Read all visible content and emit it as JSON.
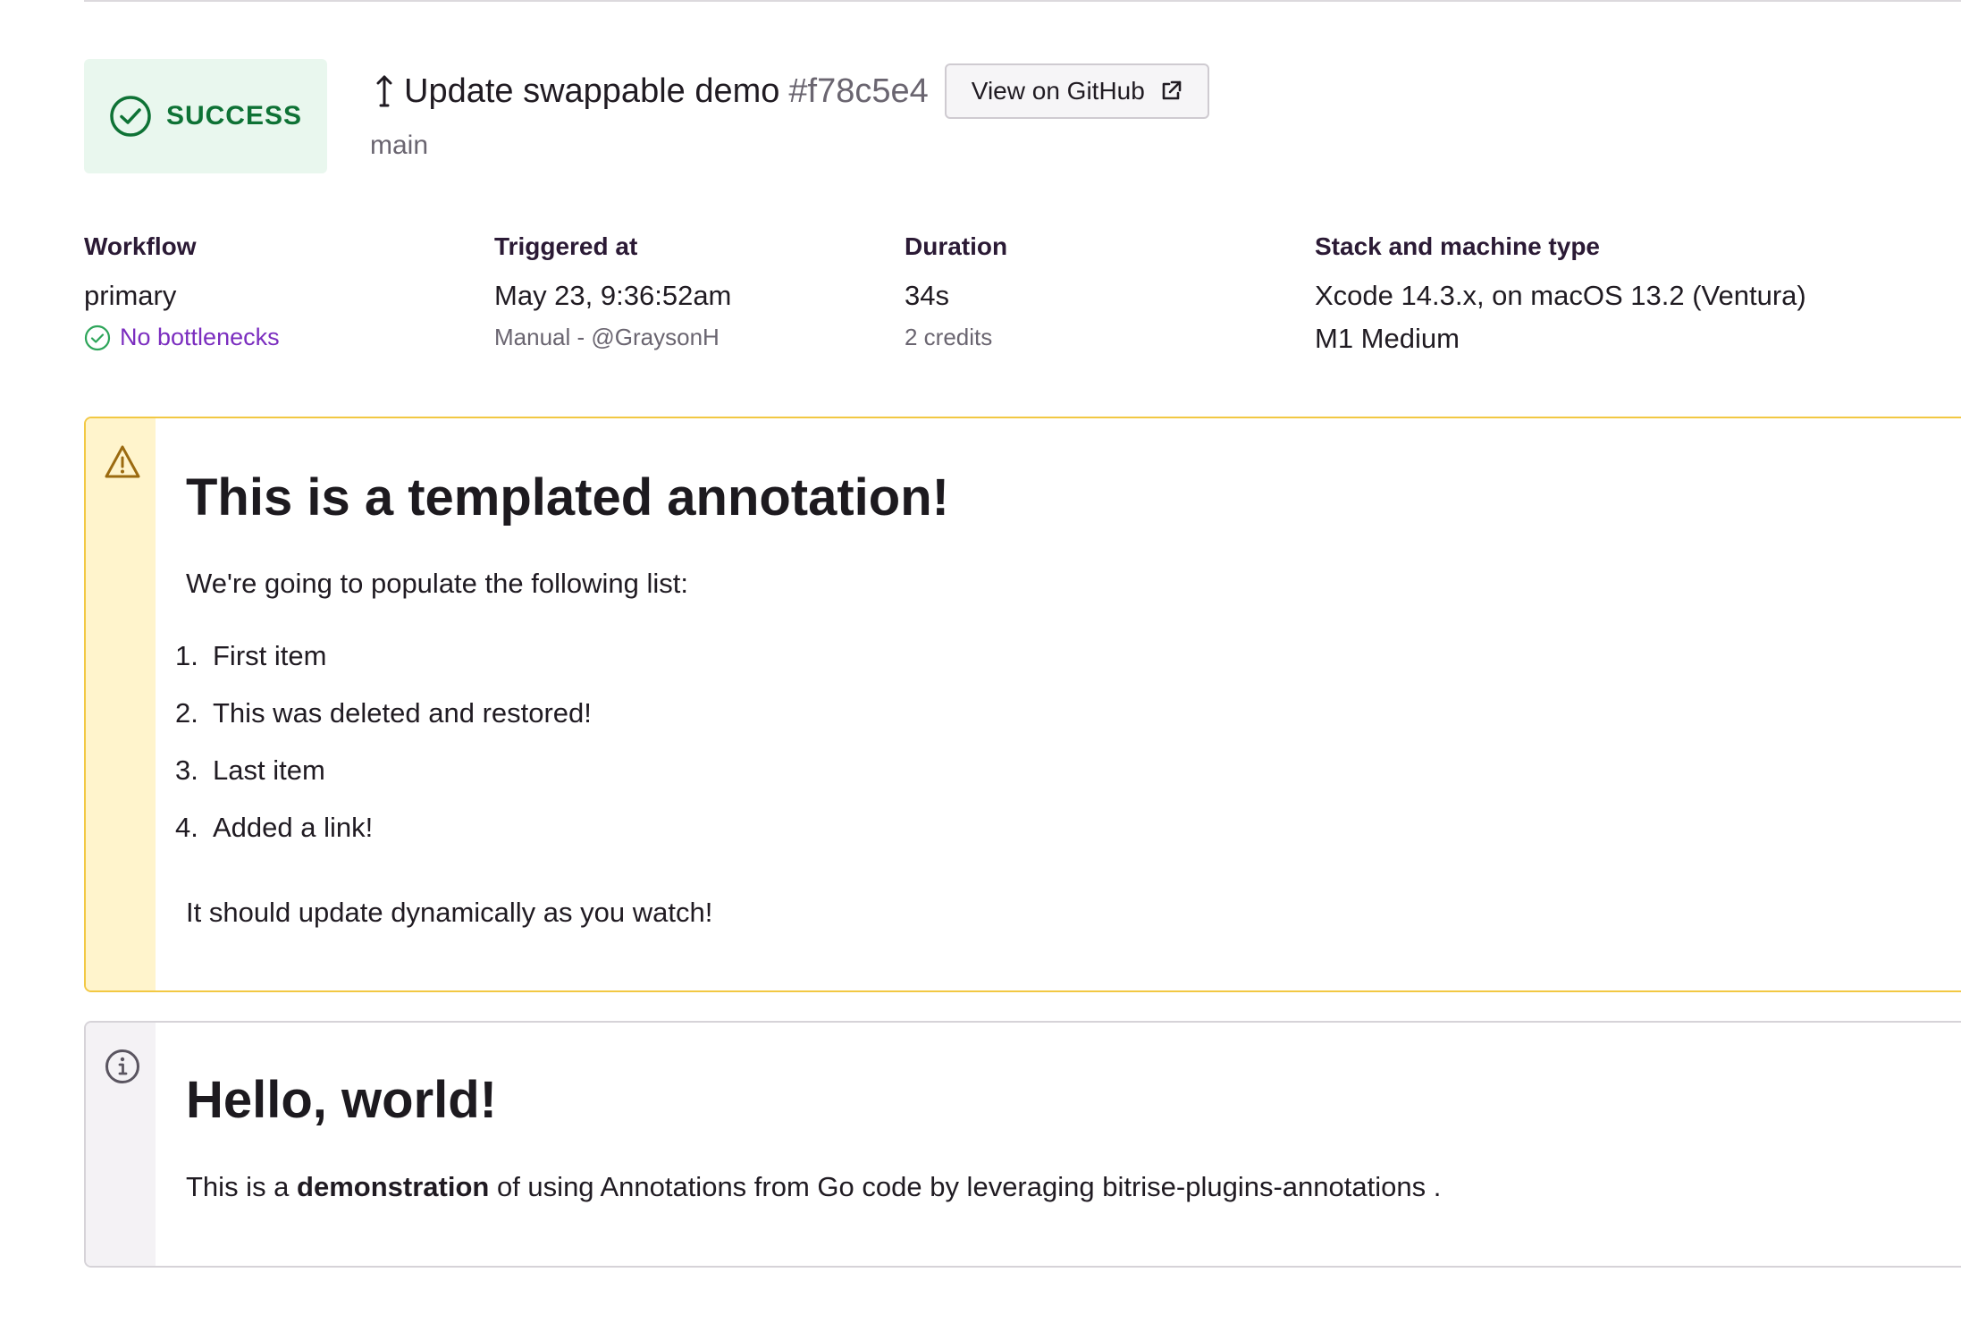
{
  "build": {
    "status": "SUCCESS",
    "status_color": "#0e7235",
    "status_bg": "#e9f7ee",
    "status_icon": "check-circle-icon",
    "commit_icon": "up-down-arrow-icon",
    "commit_title": "Update swappable demo",
    "commit_hash": "#f78c5e4",
    "github_button": "View on GitHub",
    "github_button_icon": "external-link-icon",
    "branch": "main"
  },
  "meta": {
    "workflow": {
      "label": "Workflow",
      "value": "primary",
      "sub": "No bottlenecks",
      "sub_icon": "check-circle-icon",
      "sub_color": "#7b2dbf"
    },
    "triggered": {
      "label": "Triggered at",
      "value": "May 23, 9:36:52am",
      "sub": "Manual - @GraysonH"
    },
    "duration": {
      "label": "Duration",
      "value": "34s",
      "sub": "2 credits"
    },
    "stack": {
      "label": "Stack and machine type",
      "value": "Xcode 14.3.x, on macOS 13.2 (Ventura)",
      "value2": "M1 Medium"
    }
  },
  "annotations": [
    {
      "style": "warning",
      "icon": "warning-icon",
      "border_color": "#f2c843",
      "title": "This is a templated annotation!",
      "intro": "We're going to populate the following list:",
      "items": [
        {
          "num": "1.",
          "text": "First item"
        },
        {
          "num": "2.",
          "text": "This was deleted and restored!"
        },
        {
          "num": "3.",
          "text": "Last item"
        },
        {
          "num": "4.",
          "text": "Added a link!"
        }
      ],
      "outro": "It should update dynamically as you watch!"
    },
    {
      "style": "info",
      "icon": "info-icon",
      "title": "Hello, world!",
      "body_prefix": "This is a",
      "body_bold": "demonstration",
      "body_suffix": "of using Annotations from Go code by leveraging bitrise-plugins-annotations ."
    }
  ]
}
